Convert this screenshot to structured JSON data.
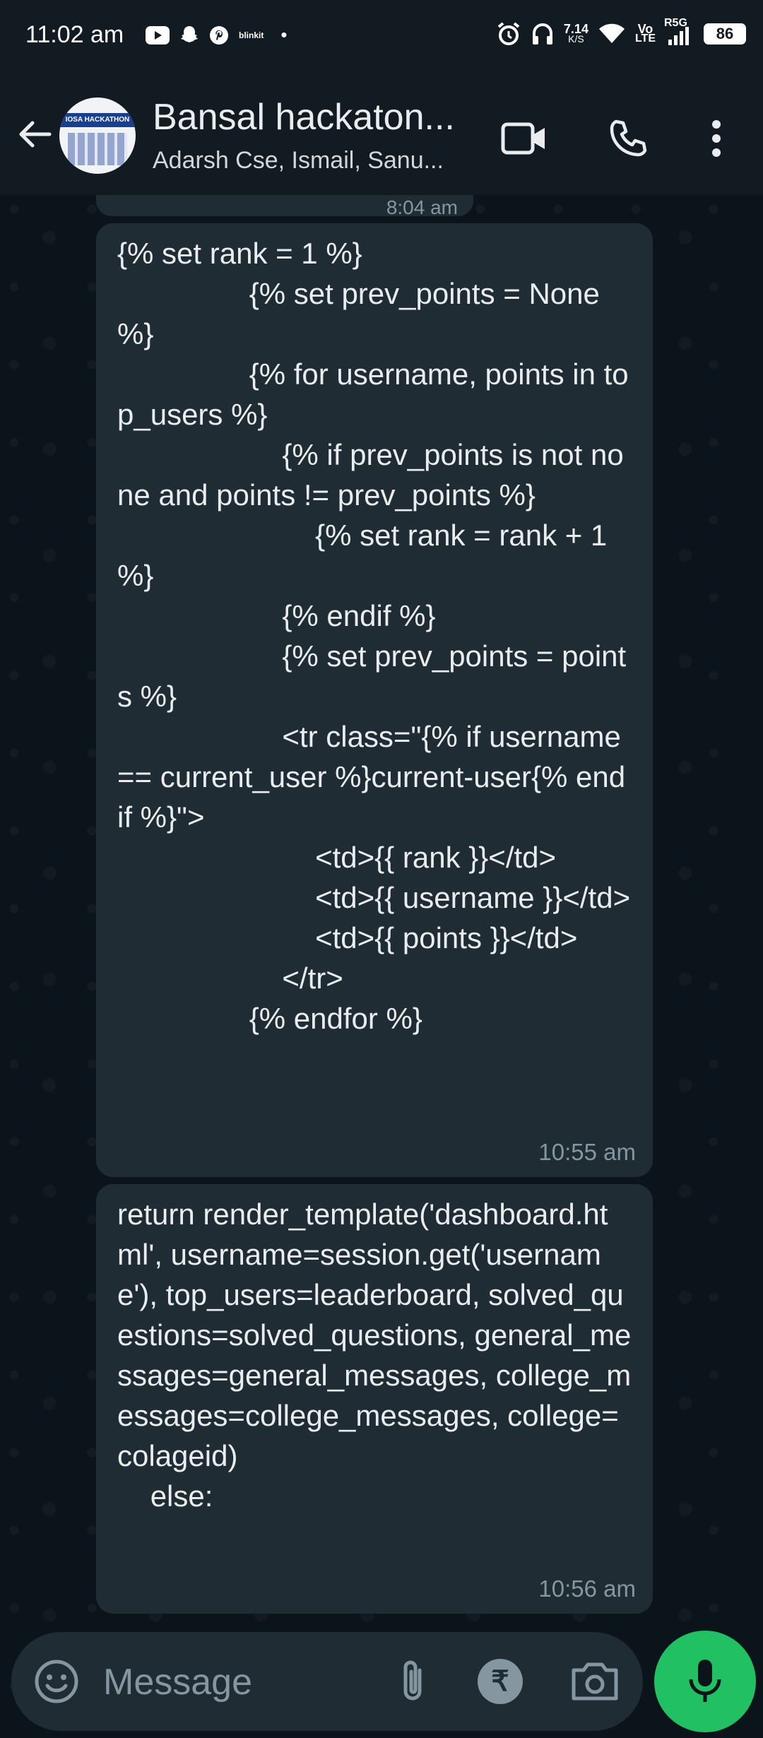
{
  "status_bar": {
    "time": "11:02 am",
    "app_icons": [
      "youtube-icon",
      "snapchat-icon",
      "pinterest-icon",
      "blinkit-icon"
    ],
    "blinkit_label": "blinkit",
    "dot": "•",
    "speed_value": "7.14",
    "speed_unit": "K/S",
    "volte_top": "Vo",
    "volte_bottom": "LTE",
    "network": "R5G",
    "battery": "86"
  },
  "header": {
    "title": "Bansal hackaton...",
    "subtitle": "Adarsh Cse, Ismail, Sanu...",
    "avatar_text": "IOSA HACKATHON",
    "icons": [
      "back-arrow-icon",
      "video-call-icon",
      "phone-call-icon",
      "more-vert-icon"
    ]
  },
  "messages": [
    {
      "id": "prev",
      "time": "8:04 am"
    },
    {
      "id": "m1",
      "text": "{% set rank = 1 %}\n                {% set prev_points = None %}\n                {% for username, points in top_users %}\n                    {% if prev_points is not none and points != prev_points %}\n                        {% set rank = rank + 1 %}\n                    {% endif %}\n                    {% set prev_points = points %}\n                    <tr class=\"{% if username == current_user %}current-user{% endif %}\">\n                        <td>{{ rank }}</td>\n                        <td>{{ username }}</td>\n                        <td>{{ points }}</td>\n                    </tr>\n                {% endfor %}",
      "time": "10:55 am"
    },
    {
      "id": "m2",
      "text": "return render_template('dashboard.html', username=session.get('username'), top_users=leaderboard, solved_questions=solved_questions, general_messages=general_messages, college_messages=college_messages, college=colageid)\n    else:",
      "time": "10:56 am"
    }
  ],
  "input_bar": {
    "placeholder": "Message",
    "rupee_symbol": "₹",
    "icons": [
      "emoji-icon",
      "attach-icon",
      "rupee-icon",
      "camera-icon",
      "mic-icon"
    ]
  },
  "colors": {
    "header_bg": "#111b21",
    "chat_bg": "#0b141a",
    "bubble_bg": "#202c33",
    "accent_green": "#21c063",
    "meta_gray": "#8696a0"
  }
}
